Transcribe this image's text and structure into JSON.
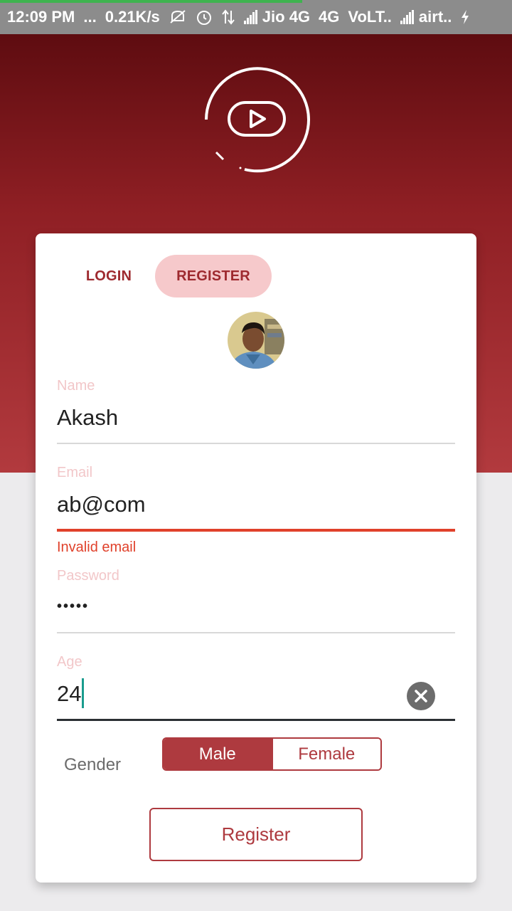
{
  "status_bar": {
    "time": "12:09 PM",
    "more": "...",
    "speed": "0.21K/s",
    "carrier1": "Jio 4G",
    "net1": "4G",
    "volte": "VoLT..",
    "carrier2": "airt..",
    "icons": [
      "mute-icon",
      "alarm-icon",
      "data-arrows-icon",
      "signal-icon",
      "signal-icon",
      "charging-icon"
    ],
    "progress": 0.59
  },
  "logo": {
    "icon": "play-logo-icon"
  },
  "tabs": {
    "login": "LOGIN",
    "register": "REGISTER",
    "active": "register"
  },
  "avatar": {
    "icon": "profile-photo"
  },
  "form": {
    "name": {
      "label": "Name",
      "value": "Akash"
    },
    "email": {
      "label": "Email",
      "value": "ab@com",
      "error": "Invalid email"
    },
    "password": {
      "label": "Password",
      "value": "•••••"
    },
    "age": {
      "label": "Age",
      "value": "24"
    },
    "gender": {
      "label": "Gender",
      "options": [
        "Male",
        "Female"
      ],
      "selected": "Male"
    },
    "submit": "Register"
  },
  "colors": {
    "accent": "#ae3a3f",
    "tab_highlight": "#f6c9cb",
    "error": "#e0412b",
    "cursor": "#1a9c8e"
  }
}
